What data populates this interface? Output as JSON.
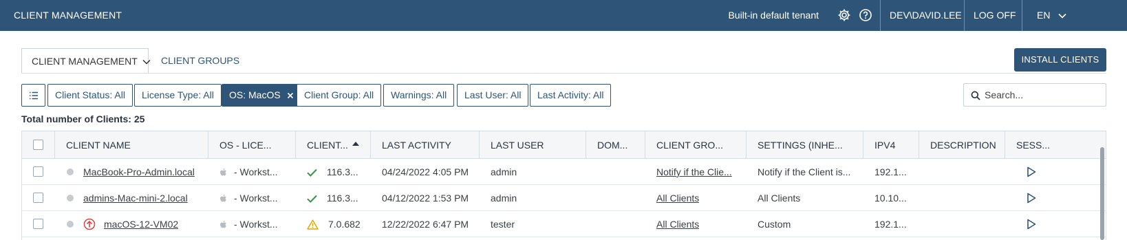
{
  "header": {
    "app_title": "CLIENT MANAGEMENT",
    "tenant": "Built-in default tenant",
    "settings_icon": "gear-icon",
    "help_icon": "help-circle-icon",
    "user": "DEV\\DAVID.LEE",
    "logoff": "LOG OFF",
    "language": "EN"
  },
  "tabs": [
    {
      "label": "CLIENT MANAGEMENT",
      "active": true
    },
    {
      "label": "CLIENT GROUPS",
      "active": false
    }
  ],
  "install_button": "INSTALL CLIENTS",
  "filters": {
    "client_status": "Client Status: All",
    "license_type": "License Type: All",
    "os": "OS: MacOS",
    "client_group": "Client Group: All",
    "warnings": "Warnings: All",
    "last_user": "Last User: All",
    "last_activity": "Last Activity: All"
  },
  "search": {
    "placeholder": "Search..."
  },
  "total": "Total number of Clients: 25",
  "columns": {
    "client_name": "CLIENT NAME",
    "os_license": "OS - LICE...",
    "client_version": "CLIENT...",
    "last_activity": "LAST ACTIVITY",
    "last_user": "LAST USER",
    "domain": "DOM...",
    "client_group": "CLIENT GRO...",
    "settings": "SETTINGS (INHE...",
    "ipv4": "IPV4",
    "description": "DESCRIPTION",
    "session": "SESS..."
  },
  "rows": [
    {
      "name": "MacBook-Pro-Admin.local",
      "os": "- Workst...",
      "version": "116.3...",
      "version_status": "ok",
      "last_activity": "04/24/2022 4:05 PM",
      "last_user": "admin",
      "domain": "",
      "group": "Notify if the Clie...",
      "settings": "Notify if the Client is...",
      "ipv4": "192.1...",
      "description": ""
    },
    {
      "name": "admins-Mac-mini-2.local",
      "os": "- Workst...",
      "version": "116.3...",
      "version_status": "ok",
      "last_activity": "04/12/2022 1:53 PM",
      "last_user": "admin",
      "domain": "",
      "group": "All Clients",
      "settings": "All Clients",
      "ipv4": "10.10...",
      "description": ""
    },
    {
      "name": "macOS-12-VM02",
      "os": "- Workst...",
      "version": "7.0.682",
      "version_status": "warning",
      "last_activity": "12/22/2022 6:47 PM",
      "last_user": "tester",
      "domain": "",
      "group": "All Clients",
      "settings": "Custom",
      "ipv4": "192.1...",
      "description": ""
    }
  ],
  "colors": {
    "primary": "#2e5577",
    "ok": "#2e9a3e",
    "warning": "#e8a400",
    "update": "#e04040"
  }
}
